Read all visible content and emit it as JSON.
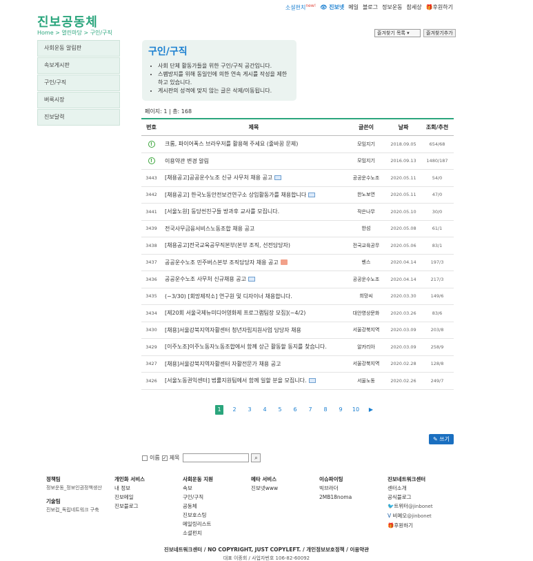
{
  "top": {
    "social": "소셜펀치",
    "social_new": "new!",
    "jinbonet": "진보넷",
    "links": [
      "메일",
      "블로그",
      "정보운동",
      "참세상"
    ],
    "donate": "후원하기"
  },
  "logo": "진보공동체",
  "breadcrumb": "Home > 열린마당 > 구인/구직",
  "favorites": {
    "select": "즐겨찾기 목록",
    "add": "즐겨찾기추가"
  },
  "sidebar": [
    "사회운동 알림판",
    "속보게시판",
    "구인/구직",
    "벼룩시장",
    "진보달력"
  ],
  "intro": {
    "title": "구인/구직",
    "bullets": [
      "사회 단체 활동가들을 위한 구인/구직 공간입니다.",
      "스팸방지를 위해 동일인에 의한 연속 게시를 작성을 제한하고 있습니다.",
      "게시판의 성격에 맞지 않는 글은 삭제/이동됩니다."
    ]
  },
  "page_info": "페이지: 1 | 총: 168",
  "table": {
    "headers": [
      "번호",
      "제목",
      "글쓴이",
      "날짜",
      "조회/추천"
    ],
    "rows": [
      {
        "no": "!",
        "title": "크롬, 파이어폭스 브라우저를 활용해 주세요 (줄바꿈 문제)",
        "author": "모임지기",
        "date": "2018.09.05",
        "views": "654/68"
      },
      {
        "no": "!",
        "title": "이용약관 변경 알림",
        "author": "모임지기",
        "date": "2016.09.13",
        "views": "1480/187"
      },
      {
        "no": "3443",
        "title": "[채용공고]공공운수노조 신규 사무처 채용 공고",
        "author": "공공운수노조",
        "date": "2020.05.11",
        "views": "54/0"
      },
      {
        "no": "3442",
        "title": "[채용공고] 한국노동안전보건연구소 상임활동가를 채용합니다",
        "author": "한노보연",
        "date": "2020.05.11",
        "views": "47/0"
      },
      {
        "no": "3441",
        "title": "[서울노원] 둥당씬친구들 방과후 교사를 모집니다.",
        "author": "작은나무",
        "date": "2020.05.10",
        "views": "30/0"
      },
      {
        "no": "3439",
        "title": "전국사무금융서비스노동조합 채용 공고",
        "author": "한섬",
        "date": "2020.05.08",
        "views": "61/1"
      },
      {
        "no": "3438",
        "title": "[채용공고]전국교육공무직본부(본부 조직, 선전담당자)",
        "author": "전국교육공무",
        "date": "2020.05.06",
        "views": "83/1"
      },
      {
        "no": "3437",
        "title": "공공운수노조 민주버스본부 조직담당자 채용 공고",
        "author": "벤스",
        "date": "2020.04.14",
        "views": "197/3"
      },
      {
        "no": "3436",
        "title": "공공운수노조 사무처 신규채용 공고",
        "author": "공공운수노조",
        "date": "2020.04.14",
        "views": "217/3"
      },
      {
        "no": "3435",
        "title": "(~3/30) [회망제작소] 연구원 및 디자이너 채용합니다.",
        "author": "희망씨",
        "date": "2020.03.30",
        "views": "149/6"
      },
      {
        "no": "3434",
        "title": "[제20회 서울국제뉴미디어영화제 프로그램팀장 모집](~4/2)",
        "author": "대안영상문화",
        "date": "2020.03.26",
        "views": "83/6"
      },
      {
        "no": "3430",
        "title": "[채용]서울강북지역자활센터 청년자립지원사업 담당자 채용",
        "author": "서울강북지역",
        "date": "2020.03.09",
        "views": "203/8"
      },
      {
        "no": "3429",
        "title": "[이주노조]이주노동자노동조합에서 함께 상근 활동할 동지를 찾습니다.",
        "author": "알카리아",
        "date": "2020.03.09",
        "views": "258/9"
      },
      {
        "no": "3427",
        "title": "[채용]서울강북지역자활센터 자활전문가 채용 공고",
        "author": "서울강북지역",
        "date": "2020.02.28",
        "views": "128/8"
      },
      {
        "no": "3426",
        "title": "[서울노동권익센터] 법률지원팀에서 함께 일할 분을 모집니다.",
        "author": "서울노동",
        "date": "2020.02.26",
        "views": "249/7"
      }
    ]
  },
  "pager": [
    "1",
    "2",
    "3",
    "4",
    "5",
    "6",
    "7",
    "8",
    "9",
    "10"
  ],
  "write": "쓰기",
  "search": {
    "name": "이름",
    "title": "제목"
  },
  "footer": {
    "c1": {
      "h1": "정책팀",
      "l1": "정보운동_정보인권정책생산",
      "h2": "기술팀",
      "l2": "진보컵_독립네트워크 구축"
    },
    "c2": {
      "h": "개인화 서비스",
      "items": [
        "내 정보",
        "진보메일",
        "진보블로그"
      ]
    },
    "c3": {
      "h": "사회운동 지원",
      "items": [
        "속보",
        "구인/구직",
        "공동체",
        "진보호스팅",
        "메일링리스트",
        "소셜펀치"
      ]
    },
    "c4": {
      "h": "메타 서비스",
      "items": [
        "진보넷www"
      ]
    },
    "c5": {
      "h": "이슈파이팅",
      "items": [
        "빅브라더",
        "2MB18noma"
      ]
    },
    "c6": {
      "h": "진보네트워크센터",
      "items": [
        "센터소개",
        "공식블로그"
      ],
      "twitter": "트위터",
      "twitter_id": "@jinbonet",
      "vimeo": "비메오",
      "vimeo_id": "@jinbonet",
      "donate": "후원하기"
    }
  },
  "bottom": {
    "line1": "진보네트워크센터 / NO COPYRIGHT, JUST COPYLEFT. / 개인정보보호정책 / 이용약관",
    "line2": "대표 이종회 / 사업자번호 106-82-60092"
  }
}
